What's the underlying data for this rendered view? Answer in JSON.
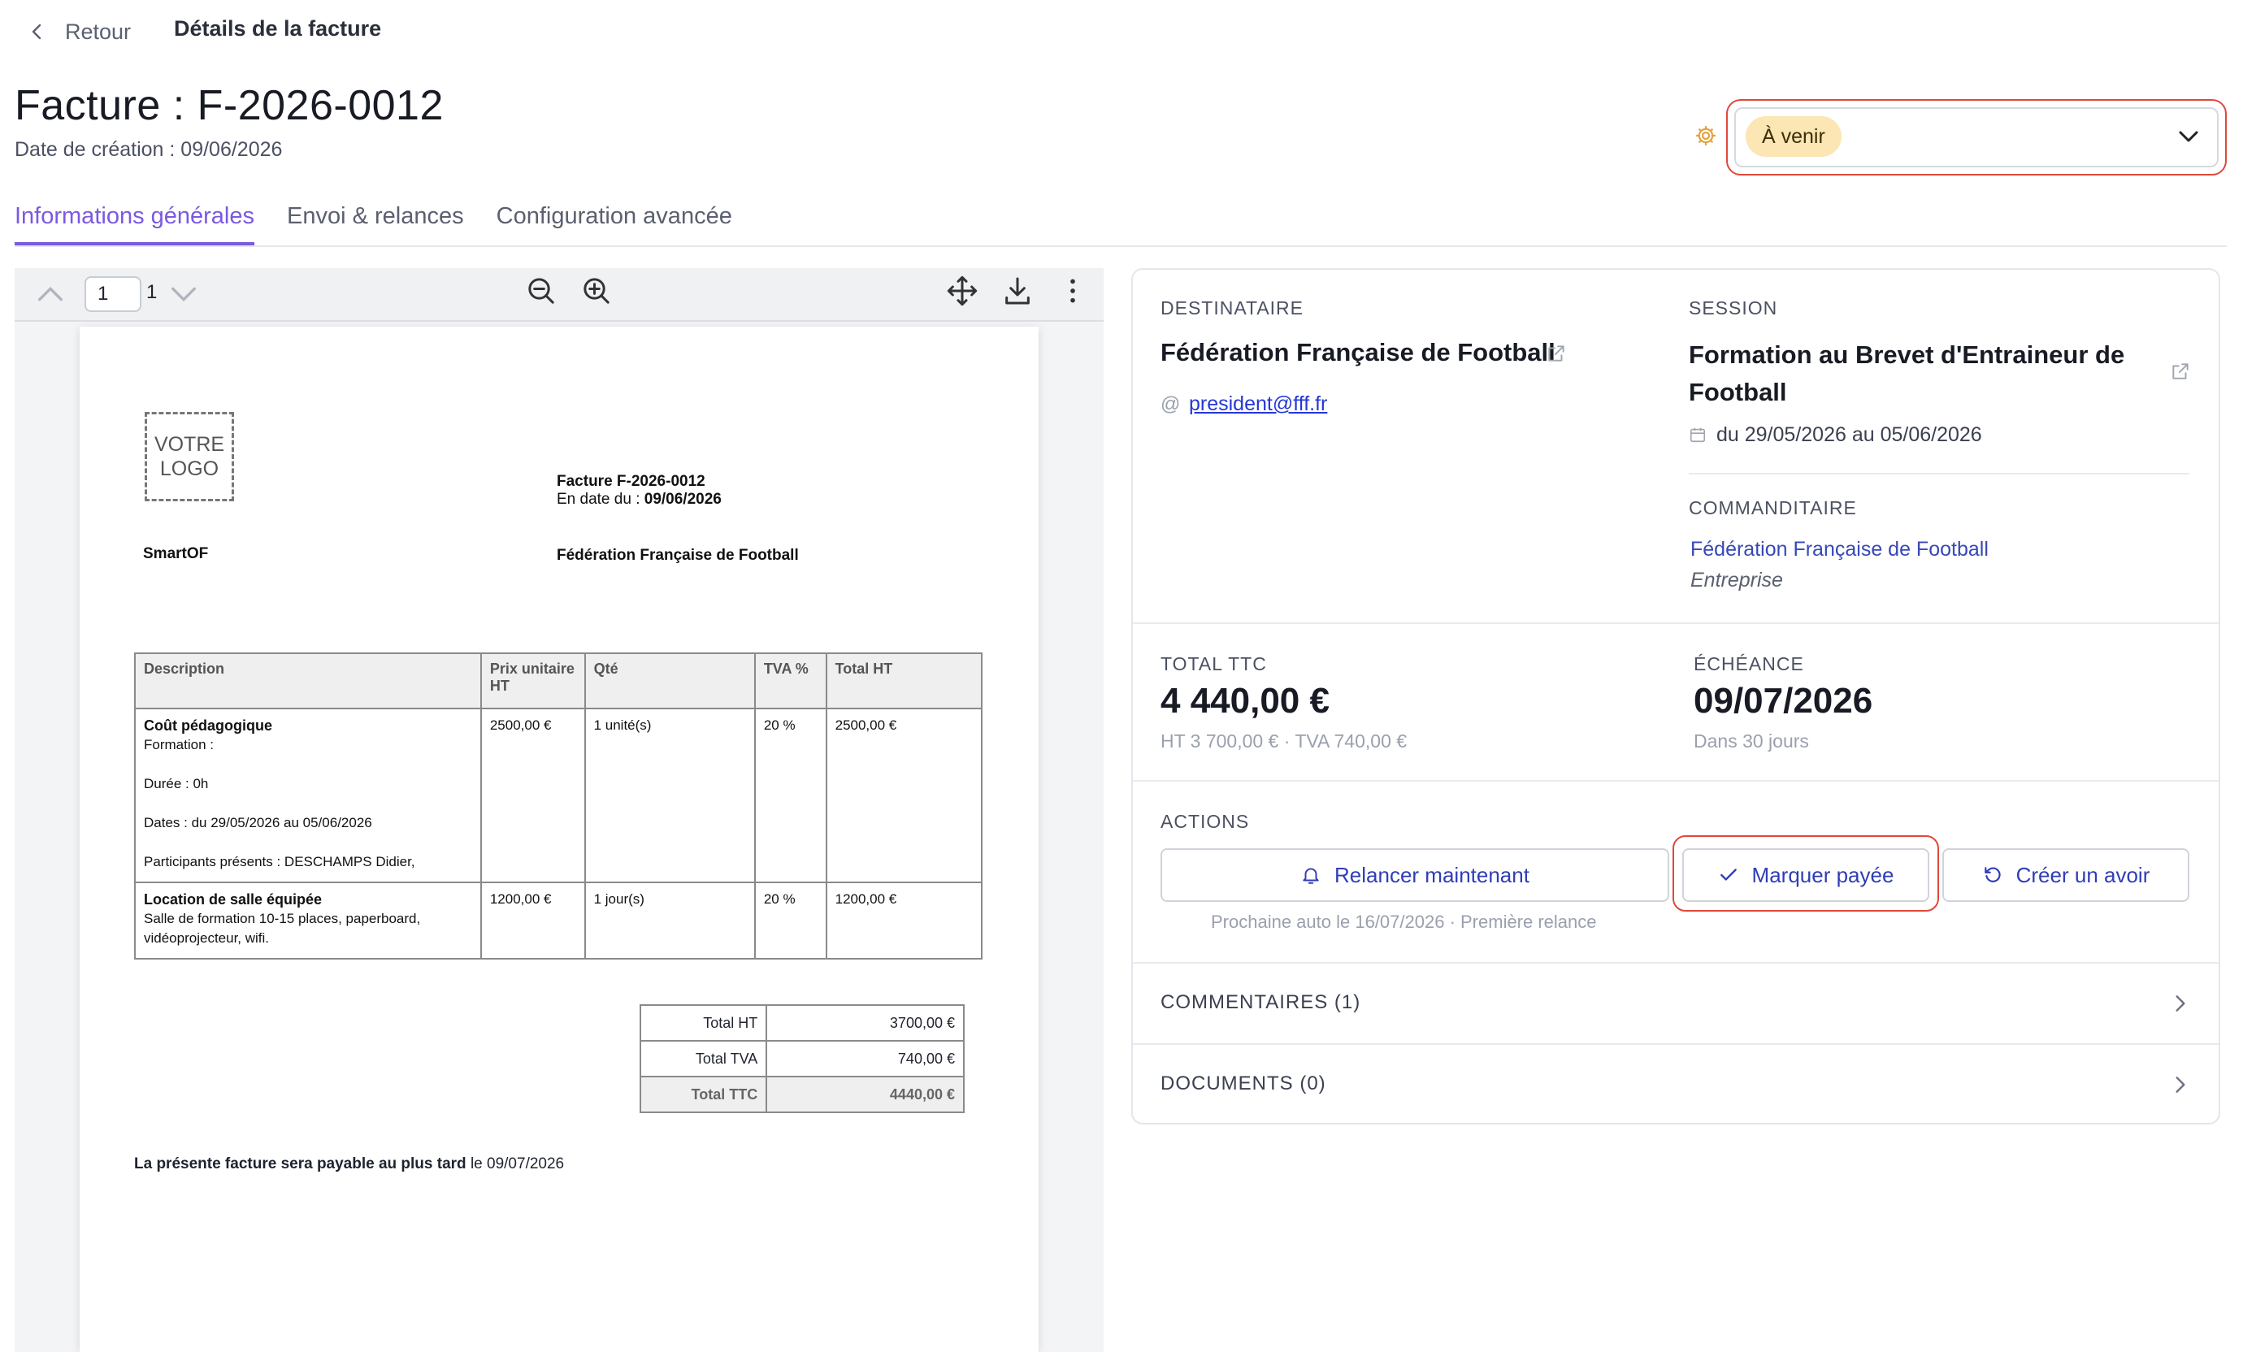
{
  "header": {
    "back_label": "Retour",
    "breadcrumb_title": "Détails de la facture",
    "page_title": "Facture : F-2026-0012",
    "created_label": "Date de création : 09/06/2026"
  },
  "status": {
    "value": "À venir",
    "chip_color": "#fbe6b4"
  },
  "tabs": [
    {
      "label": "Informations générales",
      "active": true
    },
    {
      "label": "Envoi & relances",
      "active": false
    },
    {
      "label": "Configuration avancée",
      "active": false
    }
  ],
  "viewer": {
    "page_input": "1",
    "page_total": "1"
  },
  "document": {
    "logo_text_line1": "VOTRE",
    "logo_text_line2": "LOGO",
    "invoice_title": "Facture F-2026-0012",
    "date_prefix": "En date du : ",
    "date_value": "09/06/2026",
    "seller": "SmartOF",
    "buyer": "Fédération Française de Football",
    "columns": [
      "Description",
      "Prix unitaire HT",
      "Qté",
      "TVA %",
      "Total HT"
    ],
    "items": [
      {
        "title": "Coût pédagogique",
        "lines": [
          "Formation :",
          "",
          "Durée : 0h",
          "",
          "Dates : du 29/05/2026 au 05/06/2026",
          "",
          "Participants présents :  DESCHAMPS Didier,"
        ],
        "unit_price": "2500,00 €",
        "qty": "1 unité(s)",
        "vat": "20 %",
        "total": "2500,00 €"
      },
      {
        "title": "Location de salle équipée",
        "lines": [
          "Salle de formation 10-15 places, paperboard, vidéoprojecteur, wifi."
        ],
        "unit_price": "1200,00 €",
        "qty": "1 jour(s)",
        "vat": "20 %",
        "total": "1200,00 €"
      }
    ],
    "totals": [
      {
        "label": "Total HT",
        "value": "3700,00 €"
      },
      {
        "label": "Total TVA",
        "value": "740,00 €"
      },
      {
        "label": "Total TTC",
        "value": "4440,00 €"
      }
    ],
    "payment_note_bold": "La présente facture sera payable au plus tard",
    "payment_note_date": " le 09/07/2026"
  },
  "panel": {
    "recipient_label": "DESTINATAIRE",
    "recipient_name": "Fédération Française de Football",
    "recipient_email": "president@fff.fr",
    "session_label": "SESSION",
    "session_name": "Formation au Brevet d'Entraineur de Football",
    "session_dates": "du 29/05/2026 au 05/06/2026",
    "sponsor_label": "COMMANDITAIRE",
    "sponsor_name": "Fédération Française de Football",
    "sponsor_type": "Entreprise",
    "total_label": "TOTAL TTC",
    "total_value": "4 440,00 €",
    "total_detail": "HT 3 700,00 € · TVA 740,00 €",
    "due_label": "ÉCHÉANCE",
    "due_value": "09/07/2026",
    "due_detail": "Dans 30 jours",
    "actions_label": "ACTIONS",
    "btn_remind": "Relancer maintenant",
    "btn_paid": "Marquer payée",
    "btn_credit": "Créer un avoir",
    "next_reminder": "Prochaine auto le 16/07/2026 · Première relance",
    "comments_label": "COMMENTAIRES (1)",
    "documents_label": "DOCUMENTS (0)"
  },
  "colors": {
    "accent": "#7b59e0",
    "link": "#2537d6",
    "highlight": "#e0483a"
  }
}
